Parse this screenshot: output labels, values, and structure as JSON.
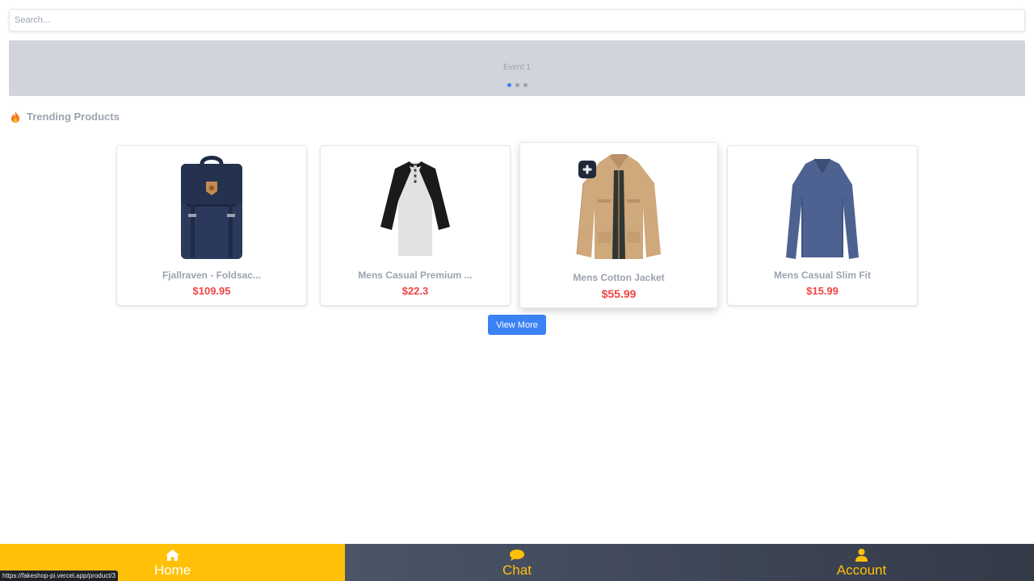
{
  "search": {
    "placeholder": "Search..."
  },
  "banner": {
    "text": "Event 1",
    "dots": 3,
    "active_dot": 0
  },
  "section": {
    "title": "Trending Products",
    "icon": "fire-icon"
  },
  "products": [
    {
      "name": "Fjallraven - Foldsac...",
      "price": "$109.95",
      "image": "backpack"
    },
    {
      "name": "Mens Casual Premium ...",
      "price": "$22.3",
      "image": "raglan-tshirt"
    },
    {
      "name": "Mens Cotton Jacket",
      "price": "$55.99",
      "image": "cotton-jacket"
    },
    {
      "name": "Mens Casual Slim Fit",
      "price": "$15.99",
      "image": "long-sleeve-tee"
    }
  ],
  "view_more_label": "View More",
  "nav": {
    "home": {
      "label": "Home",
      "icon": "home-icon"
    },
    "chat": {
      "label": "Chat",
      "icon": "chat-icon"
    },
    "account": {
      "label": "Account",
      "icon": "user-icon"
    }
  },
  "status_url": "https://fakeshop-pi.vercel.app/product/3",
  "colors": {
    "accent": "#ffc107",
    "price": "#ef4444",
    "button": "#3b82f6",
    "nav_dark": "#3b4252"
  }
}
